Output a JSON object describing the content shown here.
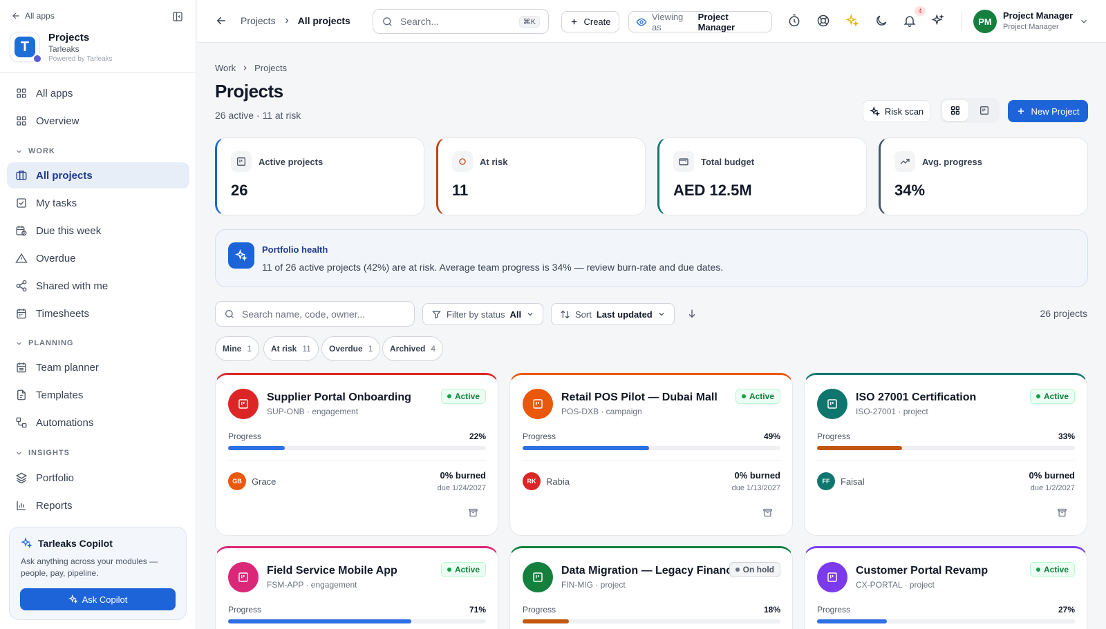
{
  "sidebar": {
    "back_label": "All apps",
    "app": {
      "logo_letter": "T",
      "title": "Projects",
      "org": "Tarleaks",
      "powered": "Powered by Tarleaks"
    },
    "items_top": [
      {
        "label": "All apps",
        "icon": "grid-icon"
      },
      {
        "label": "Overview",
        "icon": "grid-icon"
      }
    ],
    "sections": [
      {
        "title": "WORK"
      },
      {
        "title": "PLANNING"
      },
      {
        "title": "INSIGHTS"
      }
    ],
    "work_items": [
      {
        "label": "All projects",
        "icon": "folders-icon",
        "active": true
      },
      {
        "label": "My tasks",
        "icon": "checkbox-icon"
      },
      {
        "label": "Due this week",
        "icon": "calendar-clock-icon"
      },
      {
        "label": "Overdue",
        "icon": "warning-icon"
      },
      {
        "label": "Shared with me",
        "icon": "share-icon"
      },
      {
        "label": "Timesheets",
        "icon": "calendar-icon"
      }
    ],
    "planning_items": [
      {
        "label": "Team planner",
        "icon": "calendar-grid-icon"
      },
      {
        "label": "Templates",
        "icon": "file-icon"
      },
      {
        "label": "Automations",
        "icon": "workflow-icon"
      }
    ],
    "insights_items": [
      {
        "label": "Portfolio",
        "icon": "layers-icon"
      },
      {
        "label": "Reports",
        "icon": "bar-chart-icon"
      }
    ],
    "copilot": {
      "title": "Tarleaks Copilot",
      "desc": "Ask anything across your modules — people, pay, pipeline.",
      "button": "Ask Copilot"
    }
  },
  "topbar": {
    "crumb_parent": "Projects",
    "crumb_current": "All projects",
    "search_placeholder": "Search...",
    "search_kbd": "⌘K",
    "create_label": "Create",
    "viewing_prefix": "Viewing as",
    "viewing_role": "Project Manager",
    "notif_count": "4",
    "user": {
      "initials": "PM",
      "name": "Project Manager",
      "role": "Project Manager"
    }
  },
  "page": {
    "crumb": [
      "Work",
      "Projects"
    ],
    "title": "Projects",
    "subtitle": "26 active · 11 at risk",
    "risk_scan": "Risk scan",
    "new_project": "New Project"
  },
  "stats": [
    {
      "label": "Active projects",
      "value": "26",
      "color": "#1d64d8",
      "icon": "kanban-icon"
    },
    {
      "label": "At risk",
      "value": "11",
      "color": "#c2410c",
      "icon": "circle-icon"
    },
    {
      "label": "Total budget",
      "value": "AED 12.5M",
      "color": "#0f766e",
      "icon": "wallet-icon"
    },
    {
      "label": "Avg. progress",
      "value": "34%",
      "color": "#475569",
      "icon": "trending-up-icon"
    }
  ],
  "health": {
    "title": "Portfolio health",
    "text": "11 of 26 active projects (42%) are at risk. Average team progress is 34% — review burn-rate and due dates."
  },
  "filters": {
    "search_placeholder": "Search name, code, owner...",
    "status_label": "Filter by status",
    "status_value": "All",
    "sort_label": "Sort",
    "sort_value": "Last updated",
    "count": "26 projects"
  },
  "chips": [
    {
      "label": "Mine",
      "count": "1"
    },
    {
      "label": "At risk",
      "count": "11"
    },
    {
      "label": "Overdue",
      "count": "1"
    },
    {
      "label": "Archived",
      "count": "4"
    }
  ],
  "projects": [
    {
      "name": "Supplier Portal Onboarding",
      "code": "SUP-ONB · engagement",
      "status": "Active",
      "progress_label": "Progress",
      "progress": "22%",
      "progress_value": 22,
      "accent": "#dc2626",
      "bar": "#2f6fe4",
      "owner_initials": "GB",
      "owner_color": "#ea580c",
      "owner": "Grace",
      "burned": "0% burned",
      "due": "due 1/24/2027"
    },
    {
      "name": "Retail POS Pilot — Dubai Mall",
      "code": "POS-DXB · campaign",
      "status": "Active",
      "progress_label": "Progress",
      "progress": "49%",
      "progress_value": 49,
      "accent": "#ea580c",
      "bar": "#2f6fe4",
      "owner_initials": "RK",
      "owner_color": "#dc2626",
      "owner": "Rabia",
      "burned": "0% burned",
      "due": "due 1/13/2027"
    },
    {
      "name": "ISO 27001 Certification",
      "code": "ISO-27001 · project",
      "status": "Active",
      "progress_label": "Progress",
      "progress": "33%",
      "progress_value": 33,
      "accent": "#0f766e",
      "bar": "#c2570c",
      "owner_initials": "FF",
      "owner_color": "#0f766e",
      "owner": "Faisal",
      "burned": "0% burned",
      "due": "due 1/2/2027"
    },
    {
      "name": "Field Service Mobile App",
      "code": "FSM-APP · engagement",
      "status": "Active",
      "progress_label": "Progress",
      "progress": "71%",
      "progress_value": 71,
      "accent": "#db2777",
      "bar": "#2f6fe4"
    },
    {
      "name": "Data Migration — Legacy Finance",
      "code": "FIN-MIG · project",
      "status": "On hold",
      "progress_label": "Progress",
      "progress": "18%",
      "progress_value": 18,
      "accent": "#15803d",
      "bar": "#c2570c"
    },
    {
      "name": "Customer Portal Revamp",
      "code": "CX-PORTAL · project",
      "status": "Active",
      "progress_label": "Progress",
      "progress": "27%",
      "progress_value": 27,
      "accent": "#7c3aed",
      "bar": "#2f6fe4"
    }
  ]
}
